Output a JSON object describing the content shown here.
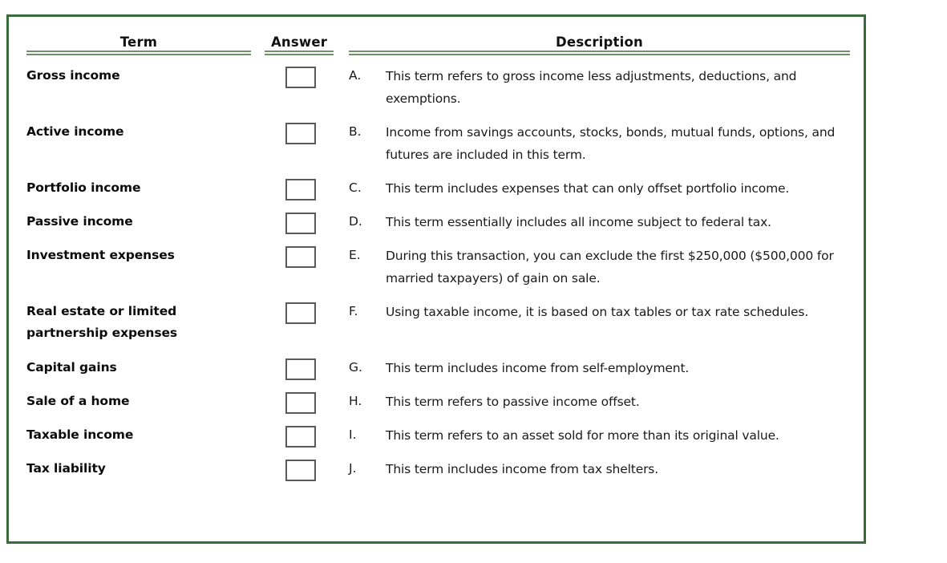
{
  "headers": {
    "term": "Term",
    "answer": "Answer",
    "description": "Description"
  },
  "colors": {
    "frame_border": "#3b6b3b",
    "rule": "#6f9068",
    "checkbox_border": "#5a5a5a",
    "text": "#1a1a1a"
  },
  "rows": [
    {
      "term": "Gross income",
      "answer": "",
      "letter": "A.",
      "description": "This term refers to gross income less adjustments, deductions, and exemptions."
    },
    {
      "term": "Active income",
      "answer": "",
      "letter": "B.",
      "description": "Income from savings accounts, stocks, bonds, mutual funds, options, and futures are included in this term."
    },
    {
      "term": "Portfolio income",
      "answer": "",
      "letter": "C.",
      "description": "This term includes expenses that can only offset portfolio income."
    },
    {
      "term": "Passive income",
      "answer": "",
      "letter": "D.",
      "description": "This term essentially includes all income subject to federal tax."
    },
    {
      "term": "Investment expenses",
      "answer": "",
      "letter": "E.",
      "description": "During this transaction, you can exclude the first $250,000 ($500,000 for married taxpayers) of gain on sale."
    },
    {
      "term": "Real estate or limited partnership expenses",
      "answer": "",
      "letter": "F.",
      "description": "Using taxable income, it is based on tax tables or tax rate schedules."
    },
    {
      "term": "Capital gains",
      "answer": "",
      "letter": "G.",
      "description": "This term includes income from self-employment."
    },
    {
      "term": "Sale of a home",
      "answer": "",
      "letter": "H.",
      "description": "This term refers to passive income offset."
    },
    {
      "term": "Taxable income",
      "answer": "",
      "letter": "I.",
      "description": "This term refers to an asset sold for more than its original value."
    },
    {
      "term": "Tax liability",
      "answer": "",
      "letter": "J.",
      "description": "This term includes income from tax shelters."
    }
  ]
}
